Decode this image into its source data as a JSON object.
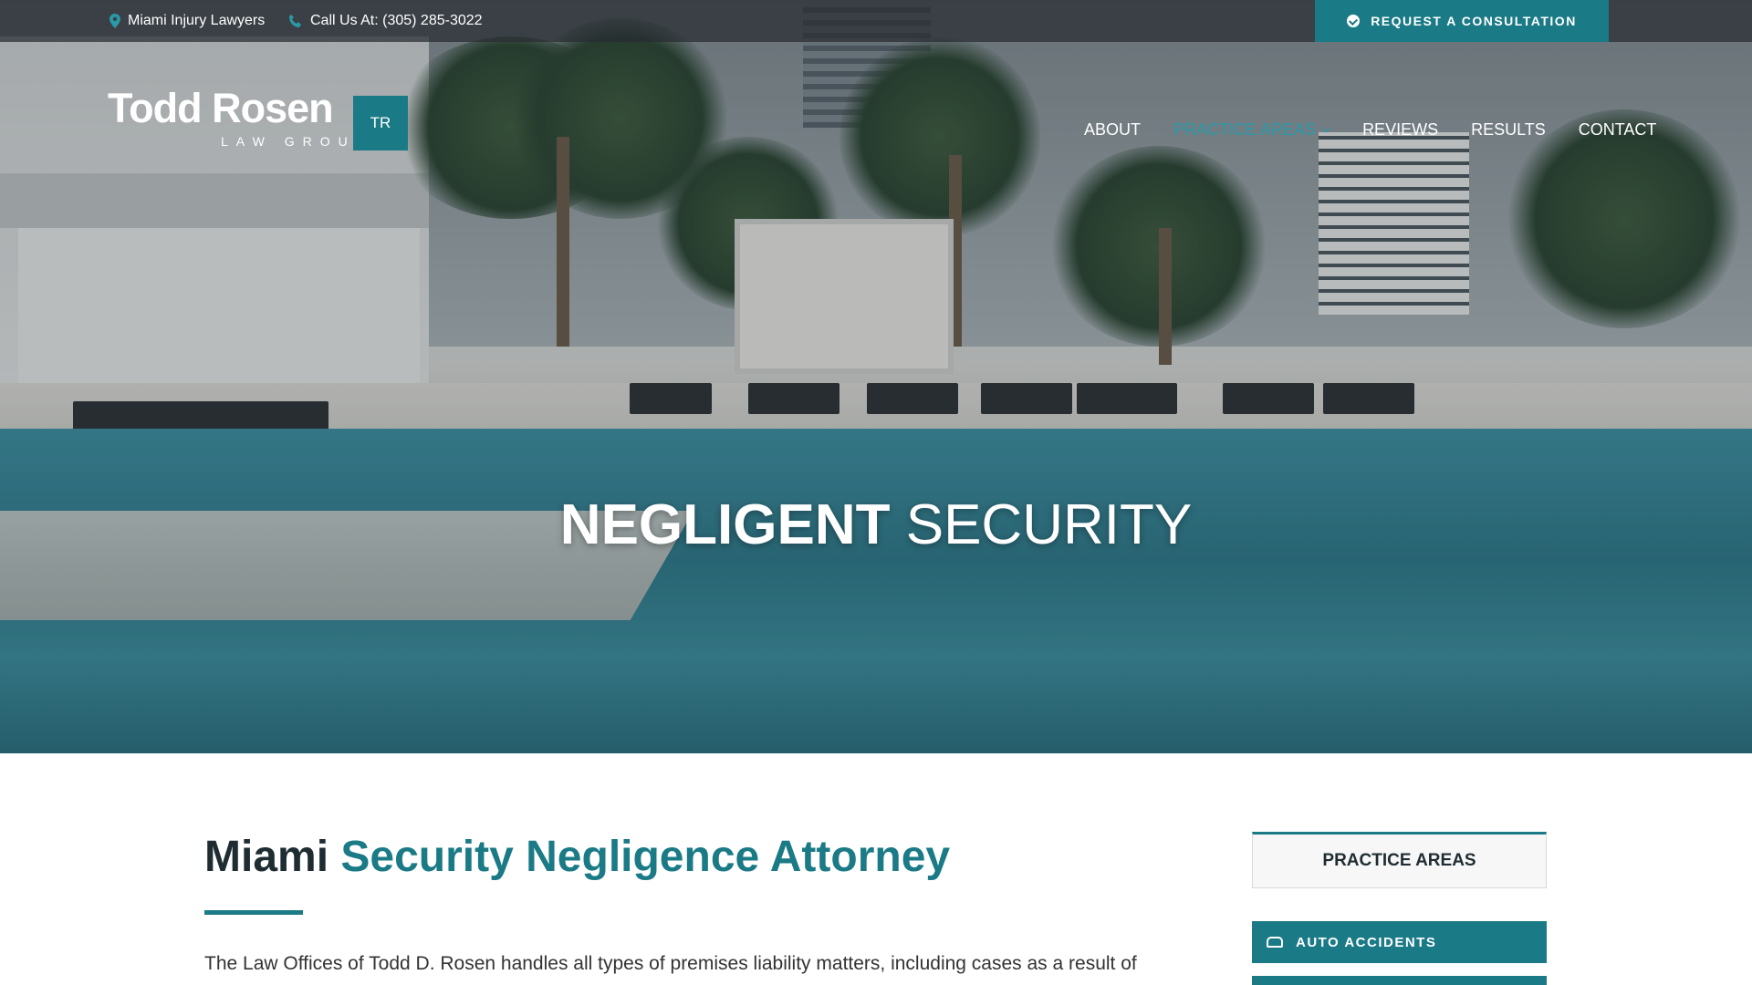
{
  "topbar": {
    "location_text": "Miami Injury Lawyers",
    "phone_text": "Call Us At: (305) 285-3022",
    "cta_label": "REQUEST A CONSULTATION"
  },
  "logo": {
    "name": "Todd Rosen",
    "subtitle": "LAW GROUP",
    "badge": "TR"
  },
  "nav": {
    "items": [
      {
        "label": "ABOUT"
      },
      {
        "label": "PRACTICE AREAS"
      },
      {
        "label": "REVIEWS"
      },
      {
        "label": "RESULTS"
      },
      {
        "label": "CONTACT"
      }
    ]
  },
  "hero": {
    "title_bold": "NEGLIGENT",
    "title_light": " SECURITY"
  },
  "content": {
    "heading_plain": "Miami ",
    "heading_accent": "Security Negligence Attorney",
    "paragraph": "The Law Offices of Todd D. Rosen handles all types of premises liability matters, including cases as a result of"
  },
  "sidebar": {
    "heading": "PRACTICE AREAS",
    "items": [
      {
        "label": "AUTO ACCIDENTS",
        "icon": "car-icon"
      }
    ]
  },
  "colors": {
    "accent": "#1a7a86",
    "nav_active": "#2a9aa8"
  }
}
